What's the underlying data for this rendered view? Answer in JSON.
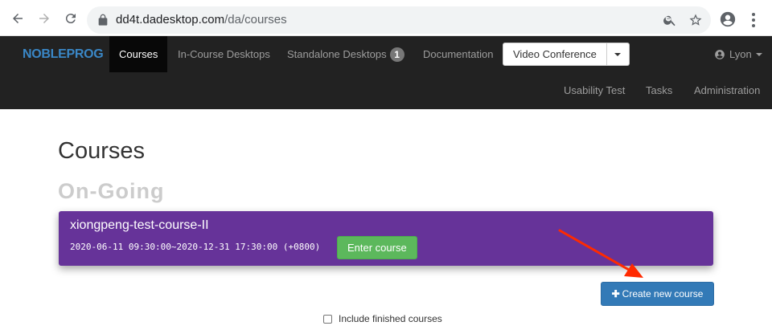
{
  "browser": {
    "url_host": "dd4t.dadesktop.com",
    "url_path": "/da/courses",
    "icons": [
      "back-icon",
      "forward-icon",
      "reload-icon",
      "lock-icon",
      "zoom-icon",
      "star-icon",
      "profile-icon",
      "kebab-menu-icon"
    ]
  },
  "navbar": {
    "brand": "NOBLEPROG",
    "links": {
      "courses": "Courses",
      "in_course_desktops": "In-Course Desktops",
      "standalone_desktops": "Standalone Desktops",
      "standalone_badge": "1",
      "documentation": "Documentation",
      "video_conference": "Video Conference",
      "user": "Lyon",
      "usability_test": "Usability Test",
      "tasks": "Tasks",
      "administration": "Administration"
    },
    "active_link": "Courses"
  },
  "main": {
    "title": "Courses",
    "section": "On-Going",
    "courses": [
      {
        "name": "xiongpeng-test-course-II",
        "dates": "2020-06-11 09:30:00~2020-12-31 17:30:00 (+0800)",
        "enter_label": "Enter course"
      }
    ],
    "create_label": "Create new course",
    "include_finished_label": "Include finished courses",
    "include_finished_checked": false
  },
  "colors": {
    "navbar_bg": "#222222",
    "brand": "#3a87c6",
    "course_card": "#663399",
    "enter_button": "#5cb85c",
    "create_button": "#337ab7",
    "annotation_arrow": "#ff2a00"
  }
}
